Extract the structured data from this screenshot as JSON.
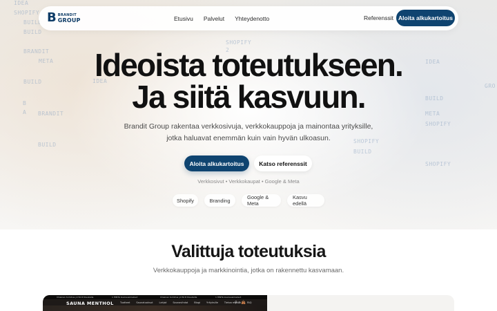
{
  "background_words": [
    {
      "text": "IDEA"
    },
    {
      "text": "SHOPIFY"
    },
    {
      "text": "BUILD"
    },
    {
      "text": "BUILD"
    },
    {
      "text": "BRANDIT"
    },
    {
      "text": "META"
    },
    {
      "text": "IDEA"
    },
    {
      "text": "BUILD"
    },
    {
      "text": "2"
    },
    {
      "text": "SHOPIFY"
    },
    {
      "text": "BUILD"
    },
    {
      "text": "BRANDIT"
    },
    {
      "text": "SHOPIFY"
    },
    {
      "text": "BUILD"
    },
    {
      "text": "BRANDIT"
    },
    {
      "text": "IDEA"
    },
    {
      "text": "BUILD"
    },
    {
      "text": "GRO"
    },
    {
      "text": "B"
    },
    {
      "text": "A"
    },
    {
      "text": "SHOPIFY"
    },
    {
      "text": "META"
    },
    {
      "text": "SHOPIFY"
    }
  ],
  "nav": {
    "logo": {
      "mark": "B",
      "line1": "BRANDIT",
      "line2": "GROUP"
    },
    "links": [
      "Etusivu",
      "Palvelut",
      "Yhteydenotto"
    ],
    "referenssit": "Referenssit",
    "cta": "Aloita alkukartoitus"
  },
  "hero": {
    "headline_line1": "Ideoista toteutukseen.",
    "headline_line2": "Ja siitä kasvuun.",
    "subtitle_line1": "Brandit Group rakentaa verkkosivuja, verkkokauppoja ja mainontaa yrityksille,",
    "subtitle_line2": "jotka haluavat enemmän kuin vain hyvän ulkoasun.",
    "primary_button": "Aloita alkukartoitus",
    "secondary_button": "Katso referenssit",
    "services_line": "Verkkosivut • Verkkokaupat • Google & Meta",
    "tags": [
      "Shopify",
      "Branding",
      "Google & Meta",
      "Kasvu edellä"
    ]
  },
  "section": {
    "title": "Valittuja toteutuksia",
    "subtitle": "Verkkokauppoja ja markkinointia, jotka on rakennettu kasvamaan."
  },
  "preview": {
    "logo": "SAUNA MENTHOL",
    "topbar": [
      "Ilmainen toimitus yli 50 € tilauksille",
      "1 HINTA kuukausimaksut",
      "Ilmainen toimitus yli 50 € tilauksille",
      "1 HINTA kuukausimaksut"
    ],
    "menu": [
      "Tuotteet",
      "Saunatuoksut",
      "Lahjat",
      "Saunavihdat",
      "Blogi",
      "Yrityksille",
      "Tietoa meistä",
      "FAQ"
    ],
    "icons": "♀ ⌕ 👜"
  }
}
